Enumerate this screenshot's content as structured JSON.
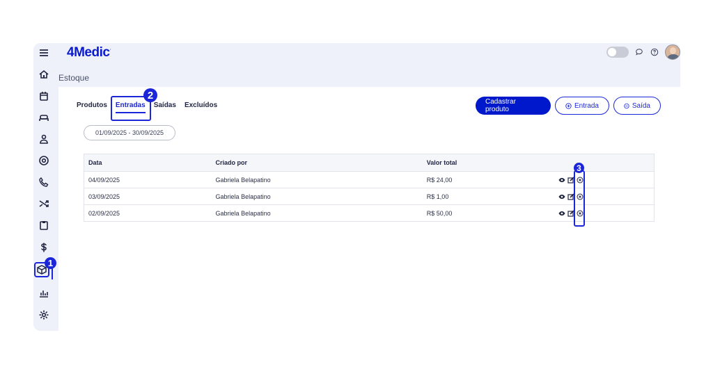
{
  "app": {
    "logo_text": "4Medic",
    "logo_mark": "·"
  },
  "page": {
    "title": "Estoque"
  },
  "tabs": [
    {
      "label": "Produtos",
      "active": false
    },
    {
      "label": "Entradas",
      "active": true
    },
    {
      "label": "Saídas",
      "active": false
    },
    {
      "label": "Excluídos",
      "active": false
    }
  ],
  "actions": {
    "create_label": "Cadastrar produto",
    "entry_label": "Entrada",
    "exit_label": "Saída"
  },
  "filter": {
    "date_range": "01/09/2025 - 30/09/2025"
  },
  "table": {
    "headers": [
      "Data",
      "Criado por",
      "Valor total"
    ],
    "rows": [
      {
        "date": "04/09/2025",
        "created_by": "Gabriela Belapatino",
        "total": "R$ 24,00"
      },
      {
        "date": "03/09/2025",
        "created_by": "Gabriela Belapatino",
        "total": "R$ 1,00"
      },
      {
        "date": "02/09/2025",
        "created_by": "Gabriela Belapatino",
        "total": "R$ 50,00"
      }
    ]
  },
  "badges": {
    "one": "1",
    "two": "2",
    "three": "3"
  },
  "sidebar": {
    "icons": [
      "menu-icon",
      "home-icon",
      "calendar-icon",
      "sofa-icon",
      "user-icon",
      "at-icon",
      "phone-icon",
      "shuffle-icon",
      "clipboard-icon",
      "dollar-icon",
      "box-icon",
      "chart-icon",
      "gear-icon"
    ]
  },
  "colors": {
    "accent": "#1a26d8",
    "primary_button": "#0018cc",
    "background": "#eef1f9"
  }
}
